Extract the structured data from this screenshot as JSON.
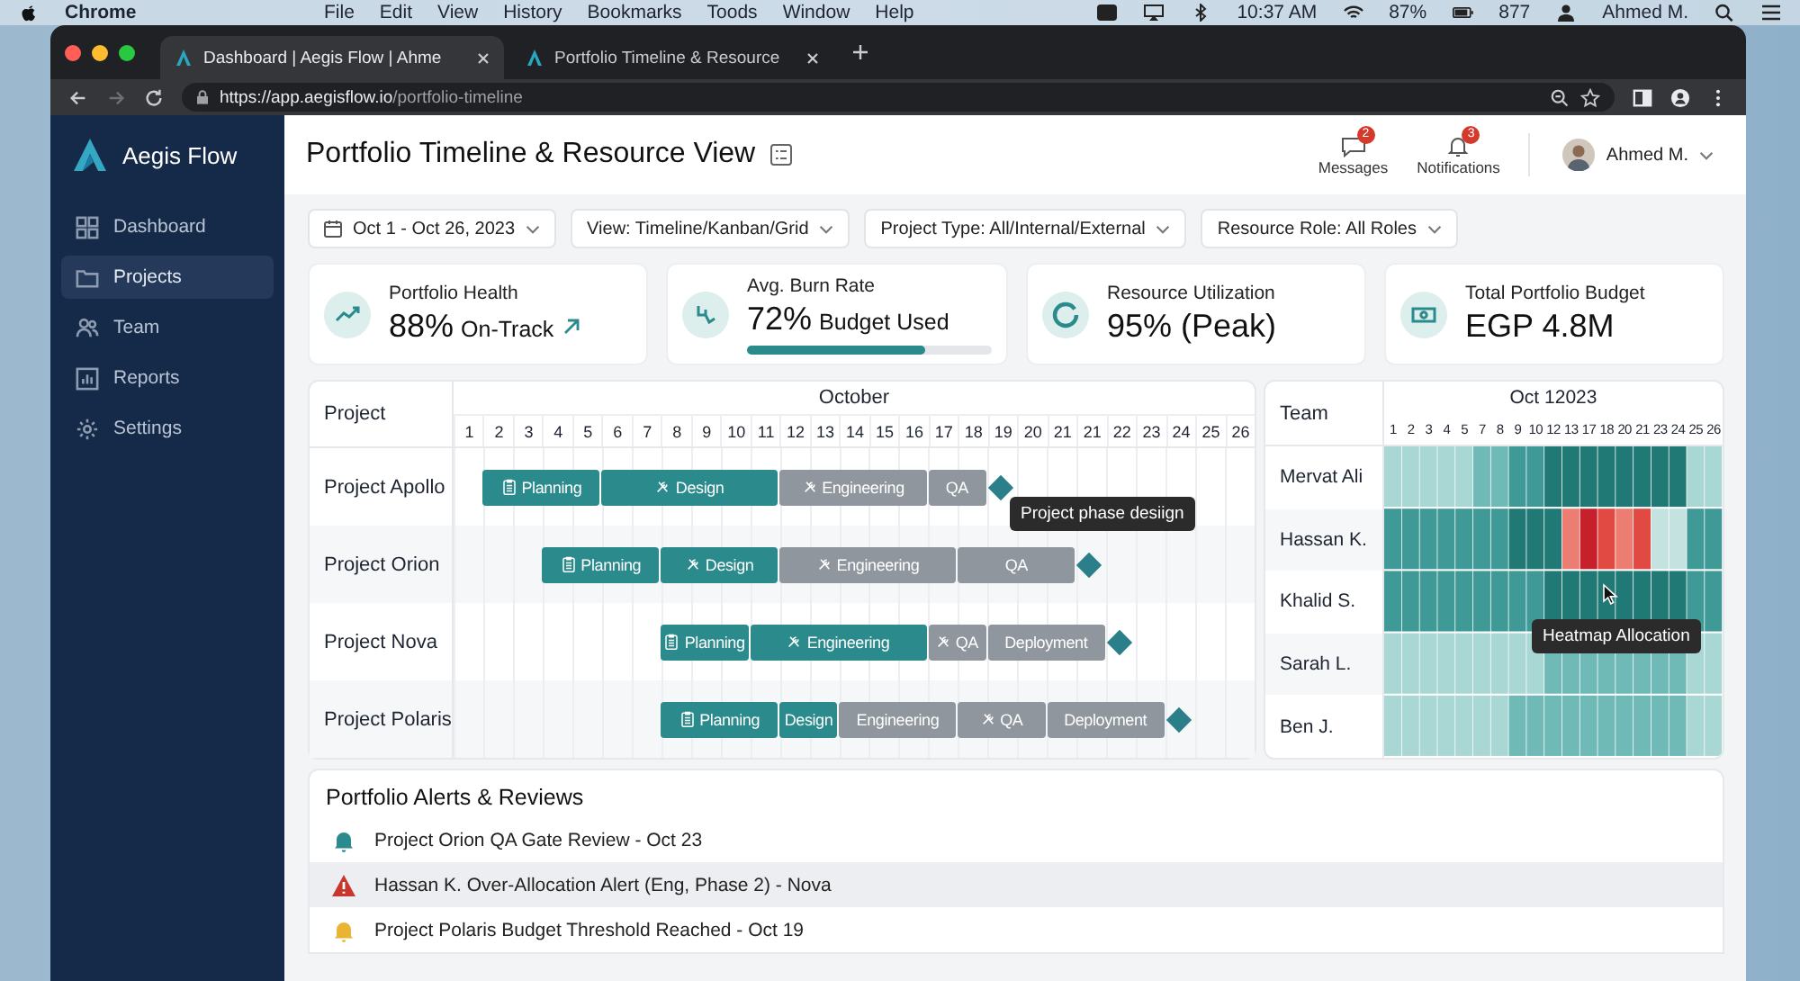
{
  "menubar": {
    "app": "Chrome",
    "menus": [
      "File",
      "Edit",
      "View",
      "History",
      "Bookmarks",
      "Toods",
      "Window",
      "Help"
    ],
    "clock": "10:37 AM",
    "battery": "87%",
    "counter": "877",
    "user": "Ahmed M."
  },
  "browser": {
    "tabs": [
      {
        "title": "Dashboard | Aegis Flow | Ahme",
        "selected": true
      },
      {
        "title": "Portfolio Timeline & Resource",
        "selected": false
      }
    ],
    "url_host": "https://app.aegisflow.io",
    "url_path": "/portfolio-timeline"
  },
  "sidebar": {
    "brand": "Aegis Flow",
    "items": [
      {
        "label": "Dashboard",
        "selected": false
      },
      {
        "label": "Projects",
        "selected": true
      },
      {
        "label": "Team",
        "selected": false
      },
      {
        "label": "Reports",
        "selected": false
      },
      {
        "label": "Settings",
        "selected": false
      }
    ]
  },
  "header": {
    "title": "Portfolio Timeline & Resource View",
    "actions": [
      {
        "label": "Messages",
        "badge": "2"
      },
      {
        "label": "Notifications",
        "badge": "3"
      }
    ],
    "user": "Ahmed M."
  },
  "filters": [
    {
      "label": "Oct 1 - Oct 26, 2023"
    },
    {
      "label": "View: Timeline/Kanban/Grid"
    },
    {
      "label": "Project Type: All/Internal/External"
    },
    {
      "label": "Resource Role: All Roles"
    }
  ],
  "kpis": [
    {
      "label": "Portfolio Health",
      "value": "88%",
      "suffix": "On-Track"
    },
    {
      "label": "Avg. Burn Rate",
      "value": "72%",
      "suffix": "Budget Used",
      "level": 0.73
    },
    {
      "label": "Resource Utilization",
      "value": "95% (Peak)"
    },
    {
      "label": "Total Portfolio Budget",
      "value": "EGP 4.8M"
    }
  ],
  "timeline": {
    "column_header": "Project",
    "month": "October",
    "days": [
      "1",
      "2",
      "3",
      "4",
      "5",
      "6",
      "7",
      "8",
      "9",
      "10",
      "11",
      "12",
      "13",
      "14",
      "15",
      "16",
      "17",
      "18",
      "19",
      "20",
      "21",
      "21",
      "22",
      "23",
      "24",
      "25",
      "26"
    ],
    "tooltip": "Project phase desiign",
    "projects": [
      {
        "name": "Project Apollo",
        "milestone": true,
        "phases": [
          {
            "label": "Planning",
            "complete": true,
            "kind": "planning"
          },
          {
            "label": "Design",
            "complete": true,
            "kind": "work"
          },
          {
            "label": "Engineering",
            "complete": false,
            "kind": "work"
          },
          {
            "label": "QA",
            "complete": false,
            "kind": "plain"
          }
        ]
      },
      {
        "name": "Project Orion",
        "milestone": true,
        "phases": [
          {
            "label": "Planning",
            "complete": true,
            "kind": "planning"
          },
          {
            "label": "Design",
            "complete": true,
            "kind": "work"
          },
          {
            "label": "Engineering",
            "complete": false,
            "kind": "work"
          },
          {
            "label": "QA",
            "complete": false,
            "kind": "plain"
          }
        ]
      },
      {
        "name": "Project Nova",
        "milestone": true,
        "phases": [
          {
            "label": "Planning",
            "complete": true,
            "kind": "planning"
          },
          {
            "label": "Engineering",
            "complete": true,
            "kind": "work"
          },
          {
            "label": "QA",
            "complete": false,
            "kind": "work"
          },
          {
            "label": "Deployment",
            "complete": false,
            "kind": "plain"
          }
        ]
      },
      {
        "name": "Project Polaris",
        "milestone": true,
        "phases": [
          {
            "label": "Planning",
            "complete": true,
            "kind": "planning"
          },
          {
            "label": "Design",
            "complete": true,
            "kind": "plain"
          },
          {
            "label": "Engineering",
            "complete": false,
            "kind": "plain"
          },
          {
            "label": "QA",
            "complete": false,
            "kind": "work"
          },
          {
            "label": "Deployment",
            "complete": false,
            "kind": "plain"
          }
        ]
      }
    ]
  },
  "heatmap": {
    "column_header": "Team",
    "month": "Oct 12023",
    "days": [
      "1",
      "2",
      "3",
      "4",
      "5",
      "7",
      "8",
      "9",
      "10",
      "12",
      "13",
      "17",
      "18",
      "20",
      "21",
      "23",
      "24",
      "25",
      "26"
    ],
    "tooltip": "Heatmap Allocation",
    "members": [
      "Mervat Ali",
      "Hassan K.",
      "Khalid S.",
      "Sarah L.",
      "Ben J."
    ]
  },
  "alerts": {
    "title": "Portfolio Alerts & Reviews",
    "items": [
      {
        "kind": "review",
        "text": "Project Orion QA Gate Review - Oct 23",
        "selected": false
      },
      {
        "kind": "warning",
        "text": "Hassan K. Over-Allocation Alert (Eng, Phase 2) - Nova",
        "selected": true
      },
      {
        "kind": "budget",
        "text": "Project Polaris Budget Threshold Reached - Oct 19",
        "selected": false
      }
    ]
  }
}
